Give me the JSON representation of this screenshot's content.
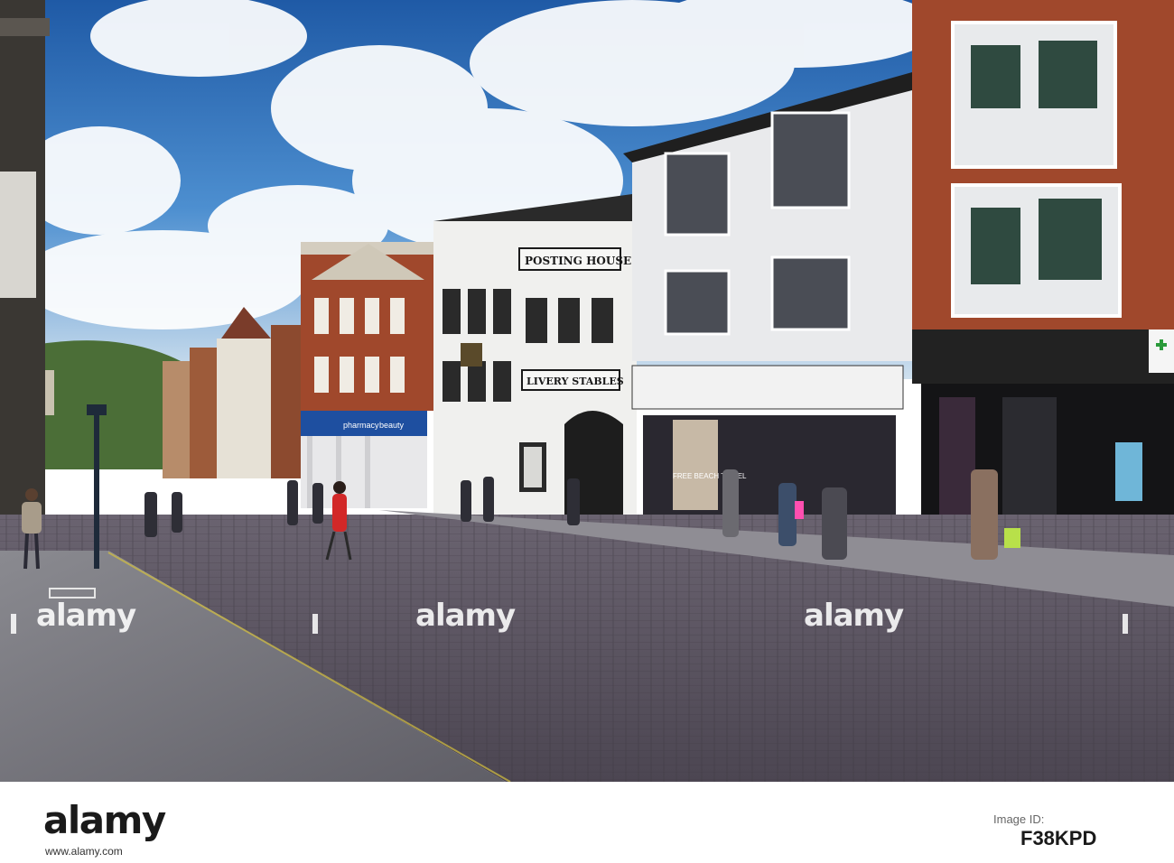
{
  "photo": {
    "signs": {
      "posting_house": "POSTING HOUSE.",
      "livery_stables": "LIVERY STABLES",
      "boots_pharmacy": "pharmacy",
      "boots_beauty": "beauty",
      "shop_window": "FREE BEACH TOWEL"
    },
    "watermarks": [
      "alamy",
      "alamy",
      "alamy"
    ],
    "colors": {
      "sky": "#2f6fb8",
      "cobbles": "#5a5560",
      "brick": "#a0482c",
      "white_building": "#e9eaec",
      "boots_blue": "#1e4fa0"
    }
  },
  "footer": {
    "brand": "alamy",
    "brand_sub": "www.alamy.com",
    "image_id_label": "Image ID:",
    "image_id": "F38KPD"
  }
}
